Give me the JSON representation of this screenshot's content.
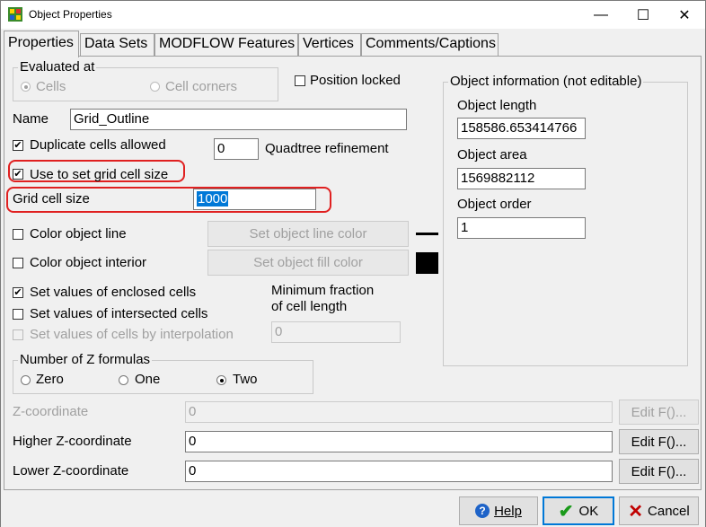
{
  "window": {
    "title": "Object Properties",
    "controls": {
      "minimize": "—",
      "maximize": "☐",
      "close": "✕"
    }
  },
  "tabs": [
    {
      "label": "Properties",
      "active": true
    },
    {
      "label": "Data Sets",
      "active": false
    },
    {
      "label": "MODFLOW Features",
      "active": false
    },
    {
      "label": "Vertices",
      "active": false
    },
    {
      "label": "Comments/Captions",
      "active": false
    }
  ],
  "evaluated_at": {
    "legend": "Evaluated at",
    "options": [
      {
        "label": "Cells",
        "selected": true,
        "enabled": false
      },
      {
        "label": "Cell corners",
        "selected": false,
        "enabled": false
      }
    ]
  },
  "position_locked": {
    "label": "Position locked",
    "checked": false
  },
  "name": {
    "label": "Name",
    "value": "Grid_Outline"
  },
  "duplicate_cells": {
    "label": "Duplicate cells allowed",
    "checked": true
  },
  "quadtree": {
    "value": "0",
    "label": "Quadtree refinement"
  },
  "use_grid_cell_size": {
    "label": "Use to set grid cell size",
    "checked": true
  },
  "grid_cell_size": {
    "label": "Grid cell size",
    "value": "1000"
  },
  "color_line": {
    "label": "Color object line",
    "checked": false,
    "button": "Set object line color"
  },
  "color_interior": {
    "label": "Color object interior",
    "checked": false,
    "button": "Set object fill color"
  },
  "enclosed": {
    "label": "Set values of enclosed cells",
    "checked": true
  },
  "intersected": {
    "label": "Set values of intersected cells",
    "checked": false
  },
  "interpolation": {
    "label": "Set values of cells by interpolation",
    "checked": false,
    "enabled": false
  },
  "min_fraction": {
    "label_line1": "Minimum fraction",
    "label_line2": "of cell length",
    "value": "0"
  },
  "z_formulas": {
    "legend": "Number of Z formulas",
    "options": [
      {
        "label": "Zero",
        "selected": false
      },
      {
        "label": "One",
        "selected": false
      },
      {
        "label": "Two",
        "selected": true
      }
    ]
  },
  "object_info": {
    "legend": "Object information (not editable)",
    "length_label": "Object length",
    "length_value": "158586.653414766",
    "area_label": "Object area",
    "area_value": "1569882112",
    "order_label": "Object order",
    "order_value": "1"
  },
  "z_coordinate": {
    "label": "Z-coordinate",
    "value": "0",
    "button": "Edit F()...",
    "enabled": false
  },
  "higher_z": {
    "label": "Higher Z-coordinate",
    "value": "0",
    "button": "Edit F()..."
  },
  "lower_z": {
    "label": "Lower Z-coordinate",
    "value": "0",
    "button": "Edit F()..."
  },
  "footer": {
    "help": "Help",
    "ok": "OK",
    "cancel": "Cancel"
  },
  "colors": {
    "highlight": "#e02020",
    "selection": "#0078d7",
    "ok_check": "#1a9a1a",
    "cancel_x": "#c00000"
  }
}
